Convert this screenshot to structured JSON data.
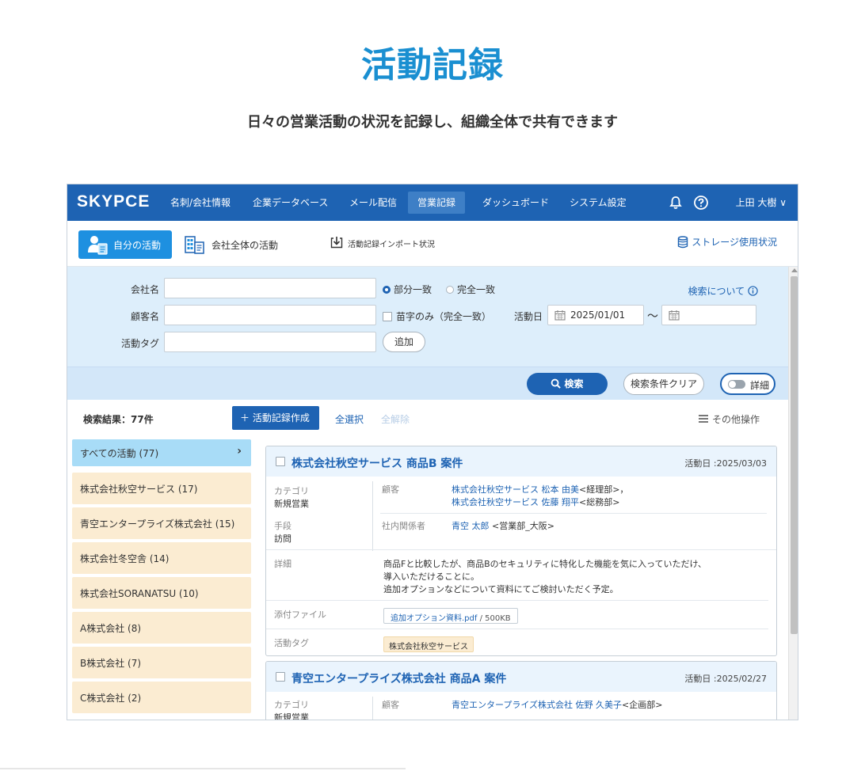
{
  "hero": {
    "title": "活動記録",
    "subtitle": "日々の営業活動の状況を記録し、組織全体で共有できます"
  },
  "nav": {
    "logo": "SKYPCE",
    "items": [
      "名刺/会社情報",
      "企業データベース",
      "メール配信",
      "営業記録",
      "ダッシュボード",
      "システム設定"
    ],
    "active_index": 3,
    "user": "上田 大樹 ∨"
  },
  "subbar": {
    "mine": "自分の活動",
    "all": "会社全体の活動",
    "import": "活動記録インポート状況",
    "storage": "ストレージ使用状況"
  },
  "search": {
    "company_label": "会社名",
    "customer_label": "顧客名",
    "tag_label": "活動タグ",
    "match_partial": "部分一致",
    "match_exact": "完全一致",
    "surname_only": "苗字のみ（完全一致）",
    "date_label": "活動日",
    "date_from": "2025/01/01",
    "date_to": "",
    "range_sep": "～",
    "add": "追加",
    "help": "検索について",
    "search_btn": "検索",
    "clear_btn": "検索条件クリア",
    "detail_btn": "詳細"
  },
  "results": {
    "count": "検索結果：77件",
    "create": "＋ 活動記録作成",
    "select_all": "全選択",
    "deselect_all": "全解除",
    "other_ops": "その他操作"
  },
  "left_list": [
    "すべての活動 (77)",
    "株式会社秋空サービス (17)",
    "青空エンタープライズ株式会社 (15)",
    "株式会社冬空舎 (14)",
    "株式会社SORANATSU (10)",
    "A株式会社 (8)",
    "B株式会社 (7)",
    "C株式会社 (2)"
  ],
  "cards": [
    {
      "title": "株式会社秋空サービス 商品B 案件",
      "date": "活動日 :2025/03/03",
      "category_label": "カテゴリ",
      "category": "新規営業",
      "method_label": "手段",
      "method": "訪問",
      "customer_label": "顧客",
      "customer_1_link": "株式会社秋空サービス 松本 由美",
      "customer_1_role": "<経理部>，",
      "customer_2_link": "株式会社秋空サービス 佐藤 翔平",
      "customer_2_role": "<総務部>",
      "staff_label": "社内関係者",
      "staff_link": "青空 太郎",
      "staff_role": "<営業部_大阪>",
      "detail_label": "詳細",
      "detail_1": "商品Fと比較したが、商品Bのセキュリティに特化した機能を気に入っていただけ、",
      "detail_2": "導入いただけることに。",
      "detail_3": "追加オプションなどについて資料にてご検討いただく予定。",
      "file_label": "添付ファイル",
      "file_name": "追加オプション資料.pdf",
      "file_size": "/ 500KB",
      "tag_label": "活動タグ",
      "tag": "株式会社秋空サービス"
    },
    {
      "title": "青空エンタープライズ株式会社 商品A 案件",
      "date": "活動日 :2025/02/27",
      "category_label": "カテゴリ",
      "category": "新規営業",
      "customer_label": "顧客",
      "customer_1_link": "青空エンタープライズ株式会社 佐野 久美子",
      "customer_1_role": "<企画部>"
    }
  ]
}
